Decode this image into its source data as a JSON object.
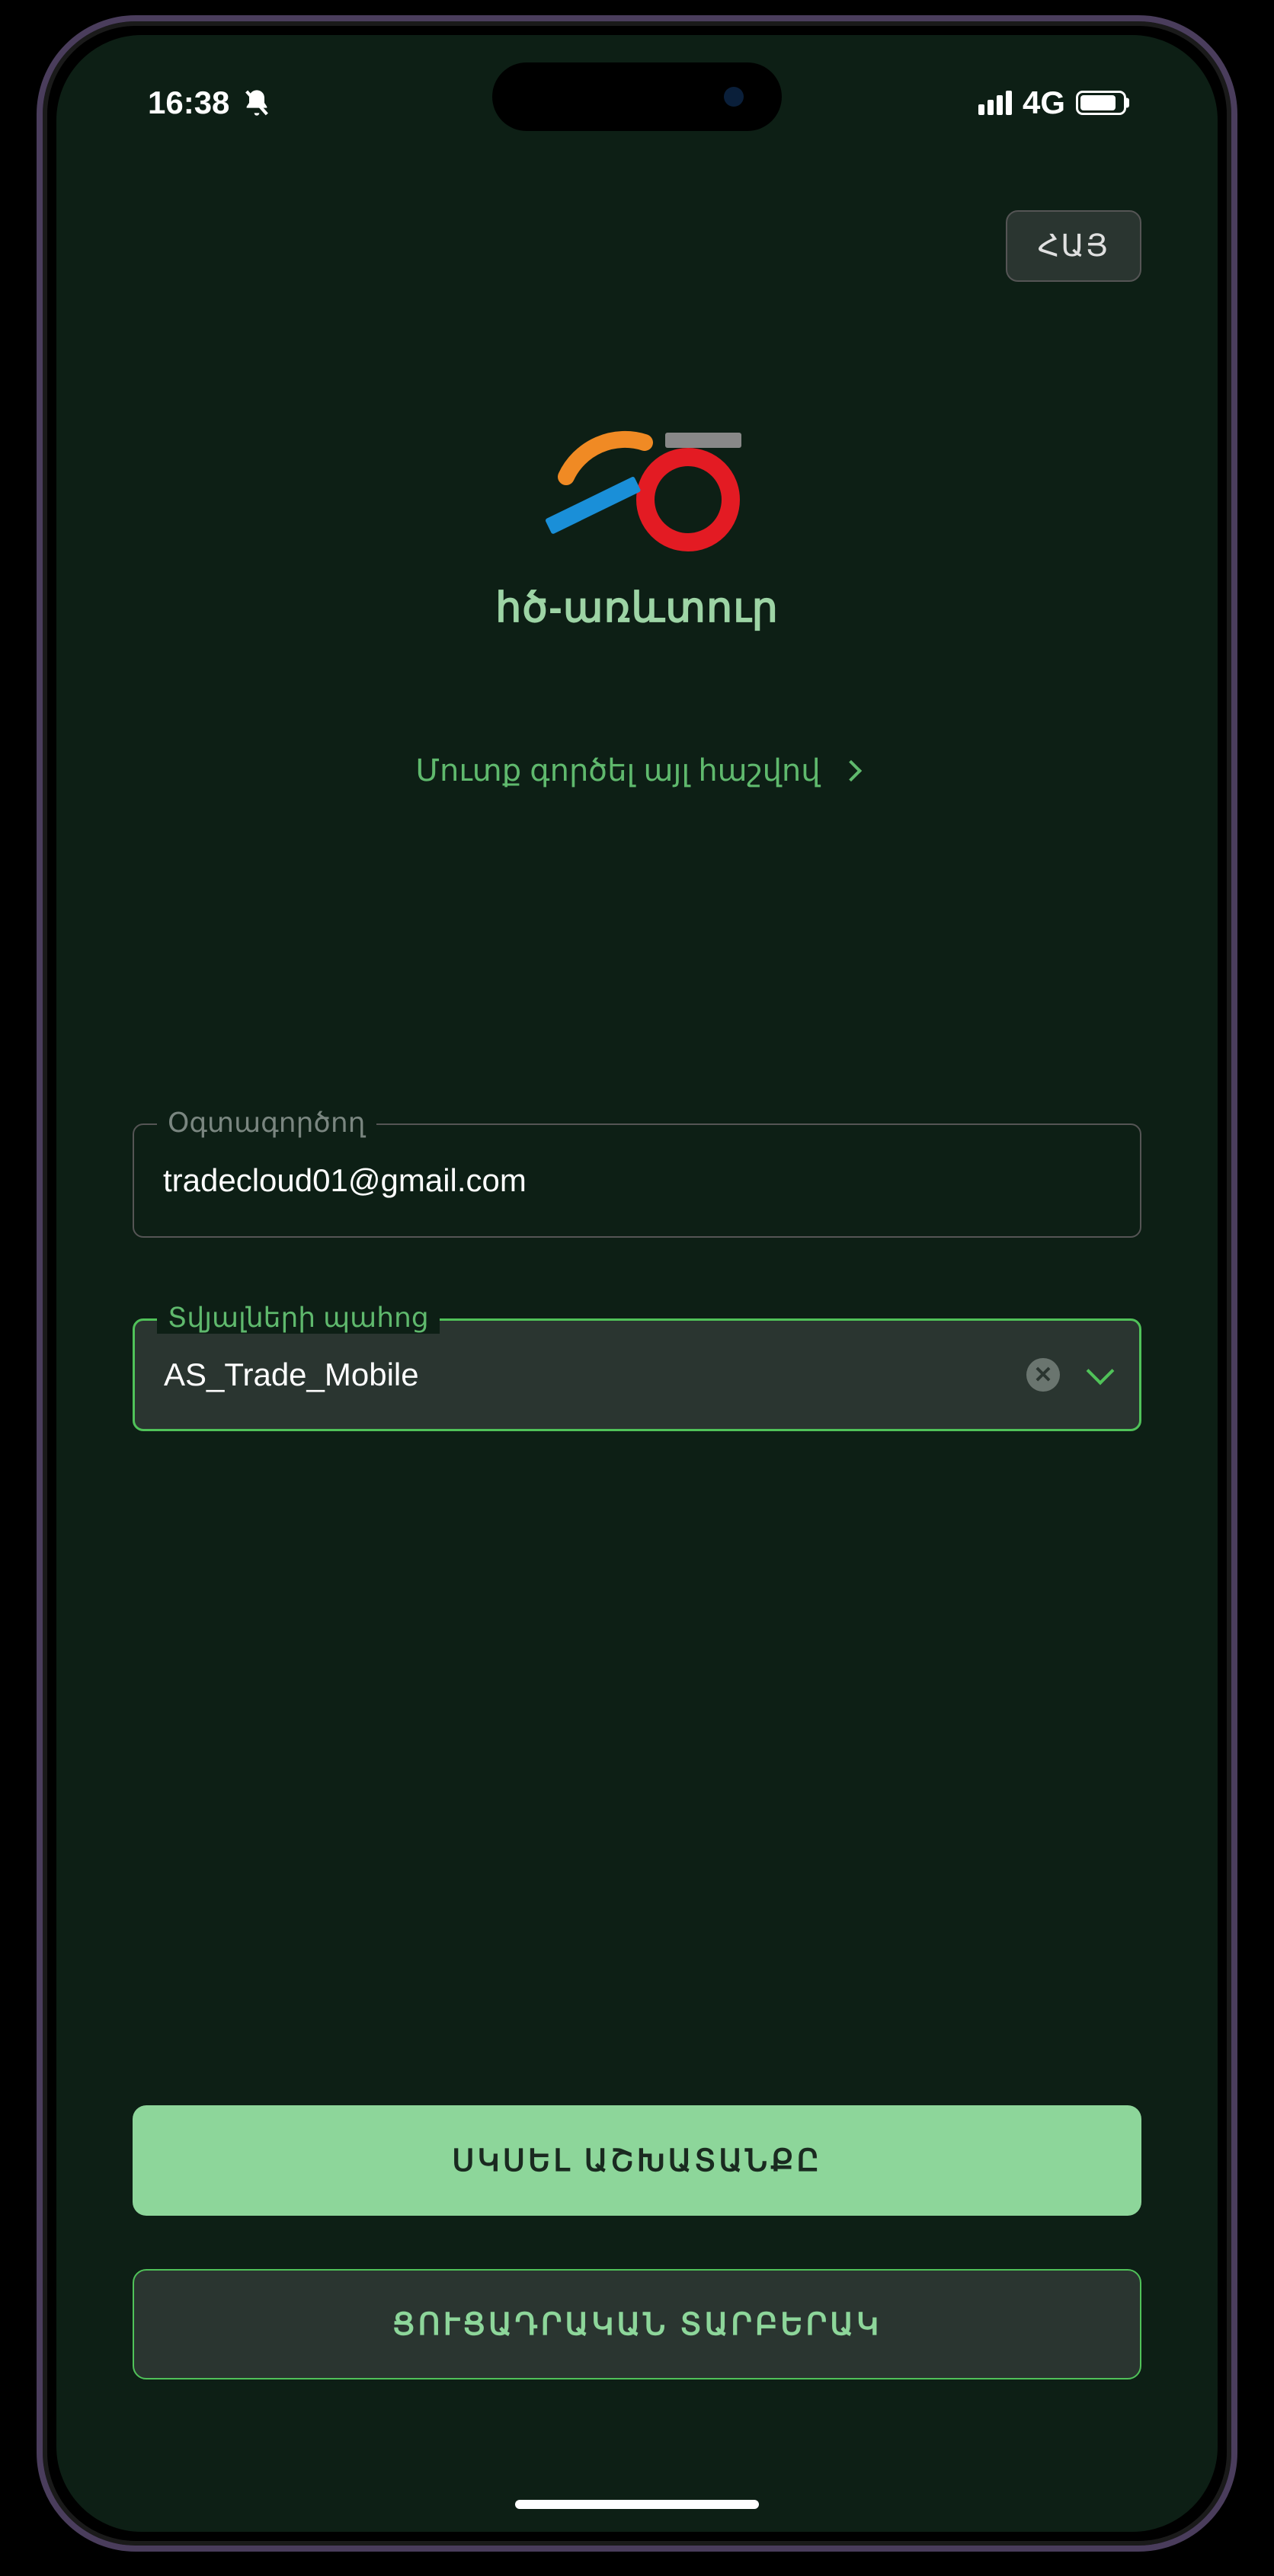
{
  "status": {
    "time": "16:38",
    "network": "4G"
  },
  "lang": "ՀԱՅ",
  "app_title": "հծ-առևտուր",
  "alt_login": "Մուտք գործել այլ հաշվով",
  "form": {
    "user_label": "Օգտագործող",
    "user_value": "tradecloud01@gmail.com",
    "db_label": "Տվյալների պահոց",
    "db_value": "AS_Trade_Mobile"
  },
  "buttons": {
    "start": "ՍԿՍԵԼ ԱՇԽԱՏԱՆՔԸ",
    "demo": "ՑՈՒՑԱԴՐԱԿԱՆ ՏԱՐԲԵՐԱԿ"
  }
}
